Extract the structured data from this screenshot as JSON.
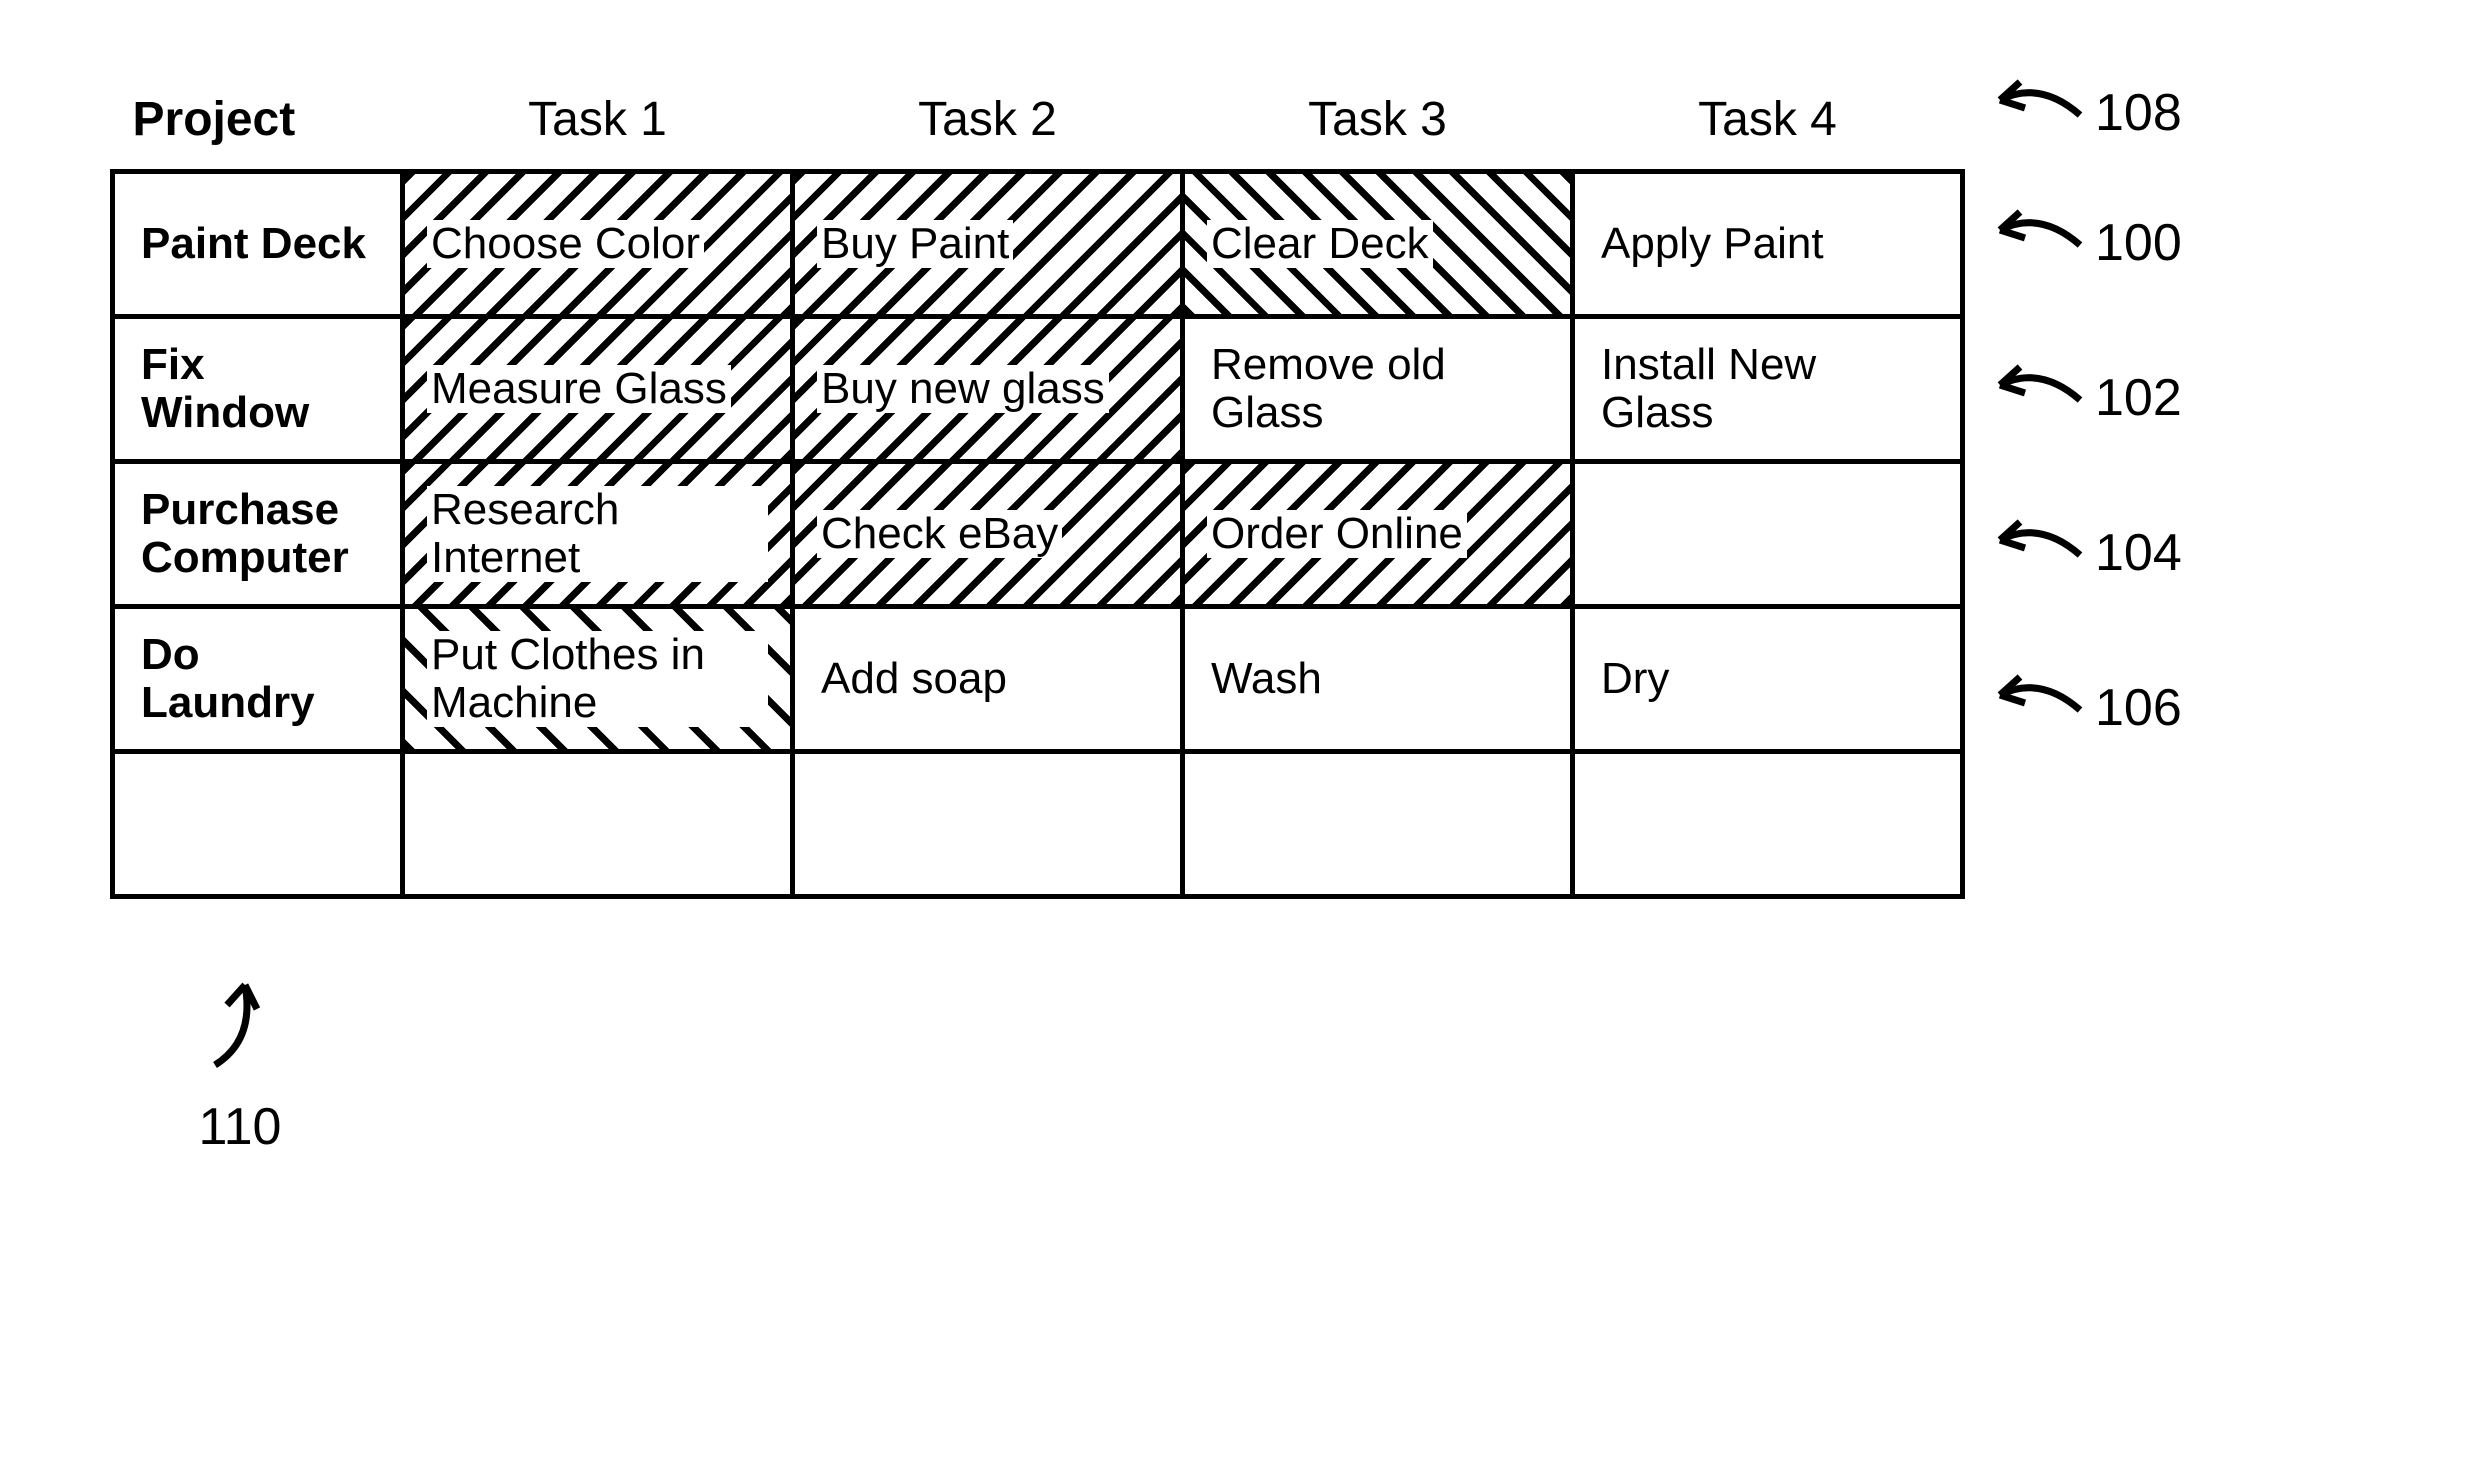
{
  "headers": {
    "project": "Project",
    "task1": "Task 1",
    "task2": "Task 2",
    "task3": "Task 3",
    "task4": "Task 4"
  },
  "rows": [
    {
      "project": "Paint Deck",
      "cells": [
        {
          "text": "Choose Color",
          "pattern": "hatch-bwd"
        },
        {
          "text": "Buy Paint",
          "pattern": "hatch-bwd"
        },
        {
          "text": "Clear Deck",
          "pattern": "hatch-fwd"
        },
        {
          "text": "Apply Paint",
          "pattern": ""
        }
      ]
    },
    {
      "project": "Fix Window",
      "cells": [
        {
          "text": "Measure Glass",
          "pattern": "hatch-bwd"
        },
        {
          "text": "Buy new glass",
          "pattern": "hatch-bwd"
        },
        {
          "text": "Remove old Glass",
          "pattern": ""
        },
        {
          "text": "Install New Glass",
          "pattern": ""
        }
      ]
    },
    {
      "project": "Purchase Computer",
      "cells": [
        {
          "text": "Research Internet",
          "pattern": "hatch-bwd"
        },
        {
          "text": "Check eBay",
          "pattern": "hatch-bwd"
        },
        {
          "text": "Order Online",
          "pattern": "hatch-bwd"
        },
        {
          "text": "",
          "pattern": ""
        }
      ]
    },
    {
      "project": "Do Laundry",
      "cells": [
        {
          "text": "Put Clothes in Machine",
          "pattern": "hatch-fwd-sparse"
        },
        {
          "text": "Add soap",
          "pattern": ""
        },
        {
          "text": "Wash",
          "pattern": ""
        },
        {
          "text": "Dry",
          "pattern": ""
        }
      ]
    },
    {
      "project": "",
      "cells": [
        {
          "text": "",
          "pattern": ""
        },
        {
          "text": "",
          "pattern": ""
        },
        {
          "text": "",
          "pattern": ""
        },
        {
          "text": "",
          "pattern": ""
        }
      ]
    }
  ],
  "refs": {
    "header": "108",
    "row0": "100",
    "row1": "102",
    "row2": "104",
    "row3": "106",
    "bottom": "110"
  }
}
